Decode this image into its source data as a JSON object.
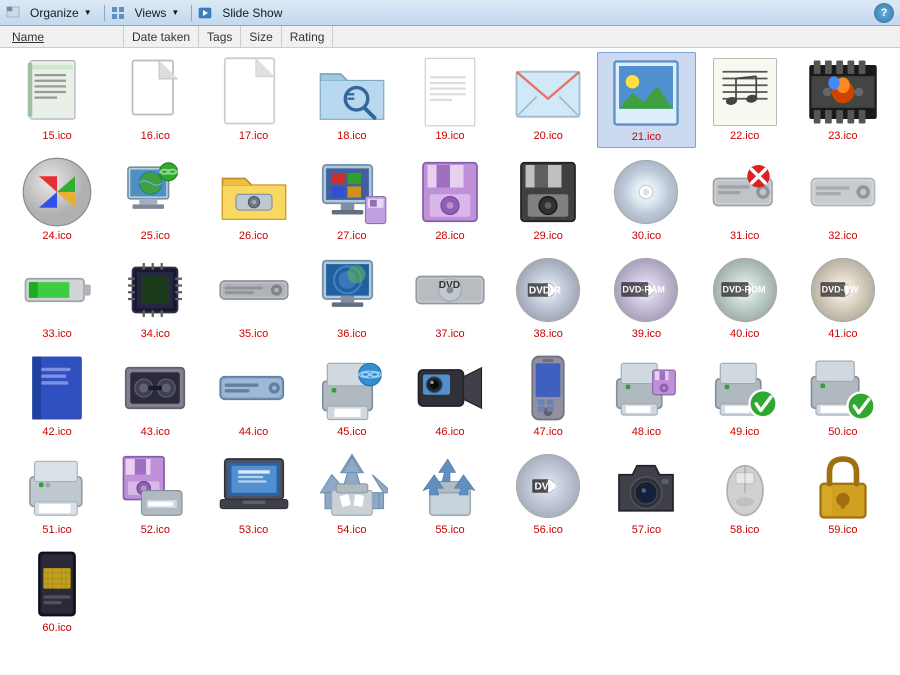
{
  "toolbar": {
    "organize_label": "Organize",
    "views_label": "Views",
    "slideshow_label": "Slide Show",
    "help_label": "?"
  },
  "columns": {
    "name": "Name",
    "date_taken": "Date taken",
    "tags": "Tags",
    "size": "Size",
    "rating": "Rating"
  },
  "files": [
    {
      "id": "15",
      "name": "15.ico",
      "type": "notepad"
    },
    {
      "id": "16",
      "name": "16.ico",
      "type": "blank"
    },
    {
      "id": "17",
      "name": "17.ico",
      "type": "blank_corner"
    },
    {
      "id": "18",
      "name": "18.ico",
      "type": "folder_search"
    },
    {
      "id": "19",
      "name": "19.ico",
      "type": "document_blank"
    },
    {
      "id": "20",
      "name": "20.ico",
      "type": "envelope"
    },
    {
      "id": "21",
      "name": "21.ico",
      "type": "photo_selected"
    },
    {
      "id": "22",
      "name": "22.ico",
      "type": "music"
    },
    {
      "id": "23",
      "name": "23.ico",
      "type": "film"
    },
    {
      "id": "24",
      "name": "24.ico",
      "type": "windows_logo"
    },
    {
      "id": "25",
      "name": "25.ico",
      "type": "computer_globe"
    },
    {
      "id": "26",
      "name": "26.ico",
      "type": "folder_drive"
    },
    {
      "id": "27",
      "name": "27.ico",
      "type": "computer_win"
    },
    {
      "id": "28",
      "name": "28.ico",
      "type": "floppy_purple"
    },
    {
      "id": "29",
      "name": "29.ico",
      "type": "floppy_black"
    },
    {
      "id": "30",
      "name": "30.ico",
      "type": "cd_silver"
    },
    {
      "id": "31",
      "name": "31.ico",
      "type": "drive_x"
    },
    {
      "id": "32",
      "name": "32.ico",
      "type": "drive_silver"
    },
    {
      "id": "33",
      "name": "33.ico",
      "type": "battery"
    },
    {
      "id": "34",
      "name": "34.ico",
      "type": "chip"
    },
    {
      "id": "35",
      "name": "35.ico",
      "type": "drive_flat"
    },
    {
      "id": "36",
      "name": "36.ico",
      "type": "computer_vista"
    },
    {
      "id": "37",
      "name": "37.ico",
      "type": "drive_dvd"
    },
    {
      "id": "38",
      "name": "38.ico",
      "type": "dvd_r"
    },
    {
      "id": "39",
      "name": "39.ico",
      "type": "dvd_ram"
    },
    {
      "id": "40",
      "name": "40.ico",
      "type": "dvd_rom"
    },
    {
      "id": "41",
      "name": "41.ico",
      "type": "dvd_rw"
    },
    {
      "id": "42",
      "name": "42.ico",
      "type": "book_blue"
    },
    {
      "id": "43",
      "name": "43.ico",
      "type": "tape"
    },
    {
      "id": "44",
      "name": "44.ico",
      "type": "drive_blue"
    },
    {
      "id": "45",
      "name": "45.ico",
      "type": "printer_globe"
    },
    {
      "id": "46",
      "name": "46.ico",
      "type": "camcorder"
    },
    {
      "id": "47",
      "name": "47.ico",
      "type": "phone"
    },
    {
      "id": "48",
      "name": "48.ico",
      "type": "printer_floppy"
    },
    {
      "id": "49",
      "name": "49.ico",
      "type": "printer_check"
    },
    {
      "id": "50",
      "name": "50.ico",
      "type": "printer_check2"
    },
    {
      "id": "51",
      "name": "51.ico",
      "type": "printer_plain"
    },
    {
      "id": "52",
      "name": "52.ico",
      "type": "floppy_printer"
    },
    {
      "id": "53",
      "name": "53.ico",
      "type": "laptop"
    },
    {
      "id": "54",
      "name": "54.ico",
      "type": "recycle_full"
    },
    {
      "id": "55",
      "name": "55.ico",
      "type": "recycle_empty"
    },
    {
      "id": "56",
      "name": "56.ico",
      "type": "dvd_disc"
    },
    {
      "id": "57",
      "name": "57.ico",
      "type": "camera"
    },
    {
      "id": "58",
      "name": "58.ico",
      "type": "mouse"
    },
    {
      "id": "59",
      "name": "59.ico",
      "type": "lock"
    },
    {
      "id": "60",
      "name": "60.ico",
      "type": "card"
    }
  ]
}
